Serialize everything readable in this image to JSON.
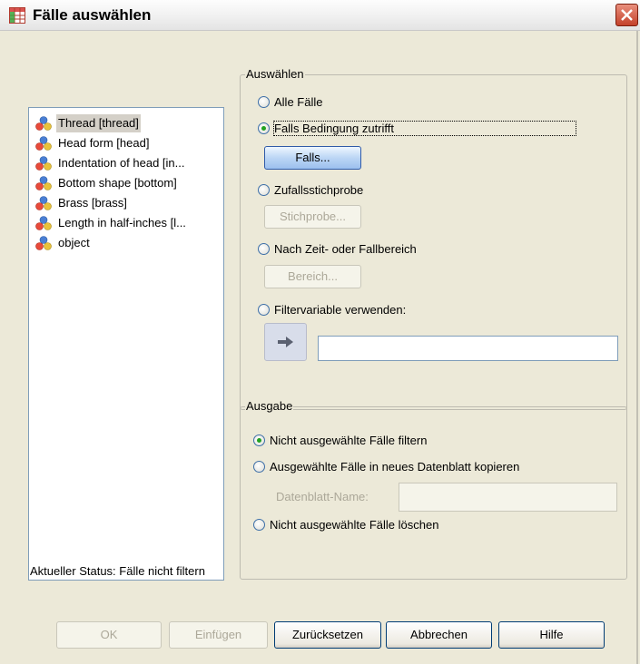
{
  "window": {
    "title": "Fälle auswählen",
    "close_label": "×"
  },
  "variables": {
    "items": [
      {
        "label": "Thread [thread]",
        "icon": "nominal-variable-icon",
        "selected": true
      },
      {
        "label": "Head form [head]",
        "icon": "nominal-variable-icon"
      },
      {
        "label": "Indentation of head [in...",
        "icon": "nominal-variable-icon"
      },
      {
        "label": "Bottom shape [bottom]",
        "icon": "nominal-variable-icon"
      },
      {
        "label": "Brass [brass]",
        "icon": "nominal-variable-icon"
      },
      {
        "label": "Length in half-inches [l...",
        "icon": "nominal-variable-icon"
      },
      {
        "label": "object",
        "icon": "nominal-variable-icon"
      }
    ]
  },
  "select_group": {
    "title": "Auswählen",
    "all_cases": "Alle Fälle",
    "if_condition": "Falls Bedingung zutrifft",
    "if_button": "Falls...",
    "random_sample": "Zufallsstichprobe",
    "sample_button": "Stichprobe...",
    "time_range": "Nach Zeit- oder Fallbereich",
    "range_button": "Bereich...",
    "filter_variable": "Filtervariable verwenden:",
    "filter_value": ""
  },
  "output_group": {
    "title": "Ausgabe",
    "filter_unselected": "Nicht ausgewählte Fälle filtern",
    "copy_to_dataset": "Ausgewählte Fälle in neues Datenblatt kopieren",
    "dataset_name_label": "Datenblatt-Name:",
    "dataset_name_value": "",
    "delete_unselected": "Nicht ausgewählte Fälle löschen"
  },
  "status": "Aktueller Status: Fälle nicht filtern",
  "buttons": {
    "ok": "OK",
    "paste": "Einfügen",
    "reset": "Zurücksetzen",
    "cancel": "Abbrechen",
    "help": "Hilfe"
  },
  "colors": {
    "selected_radio": "#21a121",
    "close_button": "#c4412a",
    "list_selection": "#d4d0c8"
  }
}
